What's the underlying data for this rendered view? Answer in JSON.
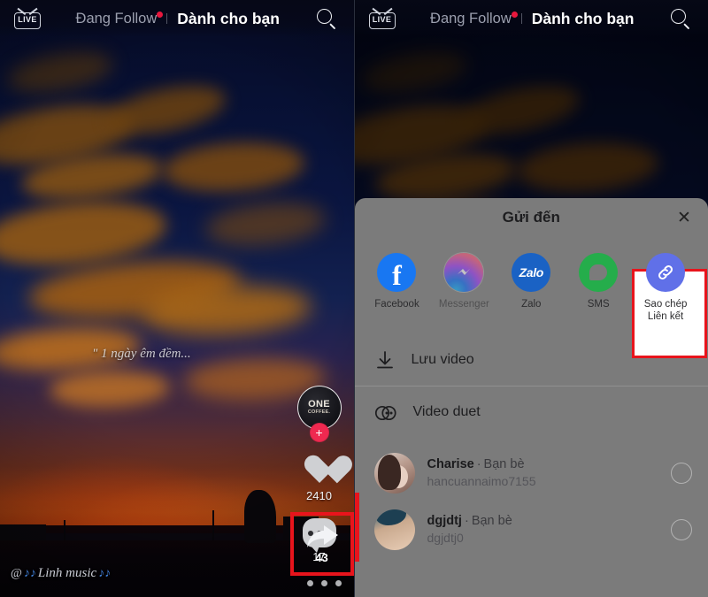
{
  "nav": {
    "live_label": "LIVE",
    "tab_following": "Đang Follow",
    "tab_foryou": "Dành cho bạn",
    "search_icon": "search-icon"
  },
  "video": {
    "caption": "\" 1 ngày êm đềm...",
    "username": "Linh music",
    "at_symbol": "@",
    "note_glyph": "♪♪"
  },
  "rail": {
    "avatar_logo_line1": "ONE",
    "avatar_logo_line2": "COFFEE.",
    "follow_plus": "+",
    "like_count": "2410",
    "comment_count": "17",
    "share_count": "43",
    "highlight_color": "#e8141c"
  },
  "sheet": {
    "title": "Gửi đến",
    "close_label": "✕",
    "apps": [
      {
        "name": "Facebook",
        "label": "Facebook",
        "color": "#1877f2",
        "glyph": "f"
      },
      {
        "name": "Messenger",
        "label": "Messenger",
        "color": "#a033ff",
        "glyph": "⚡"
      },
      {
        "name": "Zalo",
        "label": "Zalo",
        "color": "#1a62c4",
        "glyph": "Zalo"
      },
      {
        "name": "SMS",
        "label": "SMS",
        "color": "#25ad4b",
        "glyph": ""
      },
      {
        "name": "CopyLink",
        "label": "Sao chép\nLiên kết",
        "label_line1": "Sao chép",
        "label_line2": "Liên kết",
        "color": "#6070e8",
        "glyph": "link"
      }
    ],
    "actions": [
      {
        "icon": "download-icon",
        "label": "Lưu video"
      },
      {
        "icon": "duet-icon",
        "label": "Video duet"
      }
    ],
    "friends": [
      {
        "display_name": "Charise",
        "separator": "·",
        "relation": "Bạn bè",
        "handle": "hancuannaimo7155",
        "selected": false
      },
      {
        "display_name": "dgjdtj",
        "separator": "·",
        "relation": "Bạn bè",
        "handle": "dgjdtj0",
        "selected": false
      }
    ]
  }
}
